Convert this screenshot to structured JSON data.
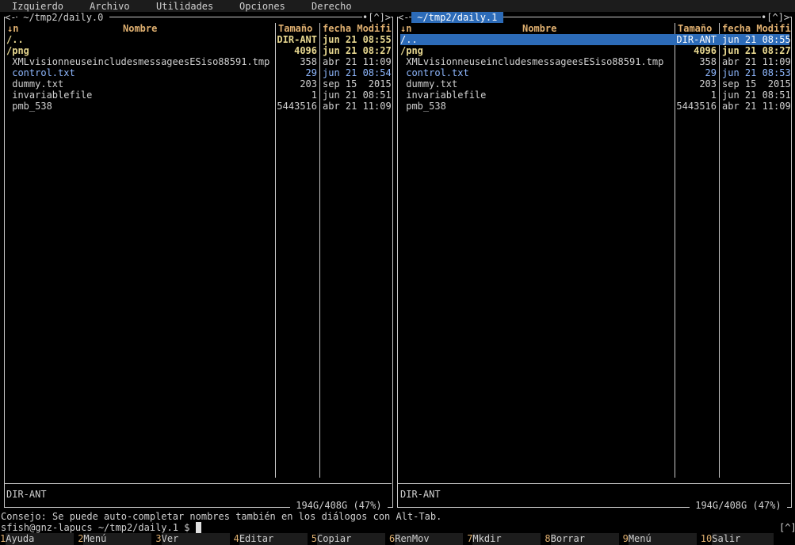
{
  "menu": [
    "Izquierdo",
    "Archivo",
    "Utilidades",
    "Opciones",
    "Derecho"
  ],
  "left_panel": {
    "path": " ~/tmp2/daily.0 ",
    "corner": "[^]",
    "col_sort": "↓n",
    "col_name": "Nombre",
    "col_size": "Tamaño",
    "col_date": "fecha Modifi",
    "rows": [
      {
        "name": "/..",
        "size": "DIR-ANT",
        "date": "jun 21 08:55",
        "kind": "dir"
      },
      {
        "name": "/png",
        "size": "4096",
        "date": "jun 21 08:27",
        "kind": "dir"
      },
      {
        "name": " XMLvisionneuseincludesmessageesESiso88591.tmp",
        "size": "358",
        "date": "abr 21 11:09",
        "kind": "file"
      },
      {
        "name": " control.txt",
        "size": "29",
        "date": "jun 21 08:54",
        "kind": "txt"
      },
      {
        "name": " dummy.txt",
        "size": "203",
        "date": "sep 15  2015",
        "kind": "file"
      },
      {
        "name": " invariablefile",
        "size": "1",
        "date": "jun 21 08:51",
        "kind": "file"
      },
      {
        "name": " pmb_538",
        "size": "5443516",
        "date": "abr 21 11:09",
        "kind": "file"
      }
    ],
    "status": "DIR-ANT",
    "disk": " 194G/408G (47%) "
  },
  "right_panel": {
    "path": " ~/tmp2/daily.1 ",
    "corner": "[^]",
    "col_sort": "↓n",
    "col_name": "Nombre",
    "col_size": "Tamaño",
    "col_date": "fecha Modifi",
    "rows": [
      {
        "name": "/..",
        "size": "DIR-ANT",
        "date": "jun 21 08:55",
        "kind": "sel"
      },
      {
        "name": "/png",
        "size": "4096",
        "date": "jun 21 08:27",
        "kind": "dir"
      },
      {
        "name": " XMLvisionneuseincludesmessageesESiso88591.tmp",
        "size": "358",
        "date": "abr 21 11:09",
        "kind": "file"
      },
      {
        "name": " control.txt",
        "size": "29",
        "date": "jun 21 08:53",
        "kind": "txt"
      },
      {
        "name": " dummy.txt",
        "size": "203",
        "date": "sep 15  2015",
        "kind": "file"
      },
      {
        "name": " invariablefile",
        "size": "1",
        "date": "jun 21 08:51",
        "kind": "file"
      },
      {
        "name": " pmb_538",
        "size": "5443516",
        "date": "abr 21 11:09",
        "kind": "file"
      }
    ],
    "status": "DIR-ANT",
    "disk": " 194G/408G (47%) "
  },
  "hint": "Consejo: Se puede auto-completar nombres también en los diálogos con Alt-Tab.",
  "prompt": "sfish@gnz-lapucs ~/tmp2/daily.1 $ ",
  "prompt_corner": "[^]",
  "fkeys": [
    {
      "n": "1",
      "label": "Ayuda"
    },
    {
      "n": "2",
      "label": "Menú"
    },
    {
      "n": "3",
      "label": "Ver"
    },
    {
      "n": "4",
      "label": "Editar"
    },
    {
      "n": "5",
      "label": "Copiar"
    },
    {
      "n": "6",
      "label": "RenMov"
    },
    {
      "n": "7",
      "label": "Mkdir"
    },
    {
      "n": "8",
      "label": "Borrar"
    },
    {
      "n": "9",
      "label": "Menú"
    },
    {
      "n": "10",
      "label": "Salir"
    }
  ]
}
